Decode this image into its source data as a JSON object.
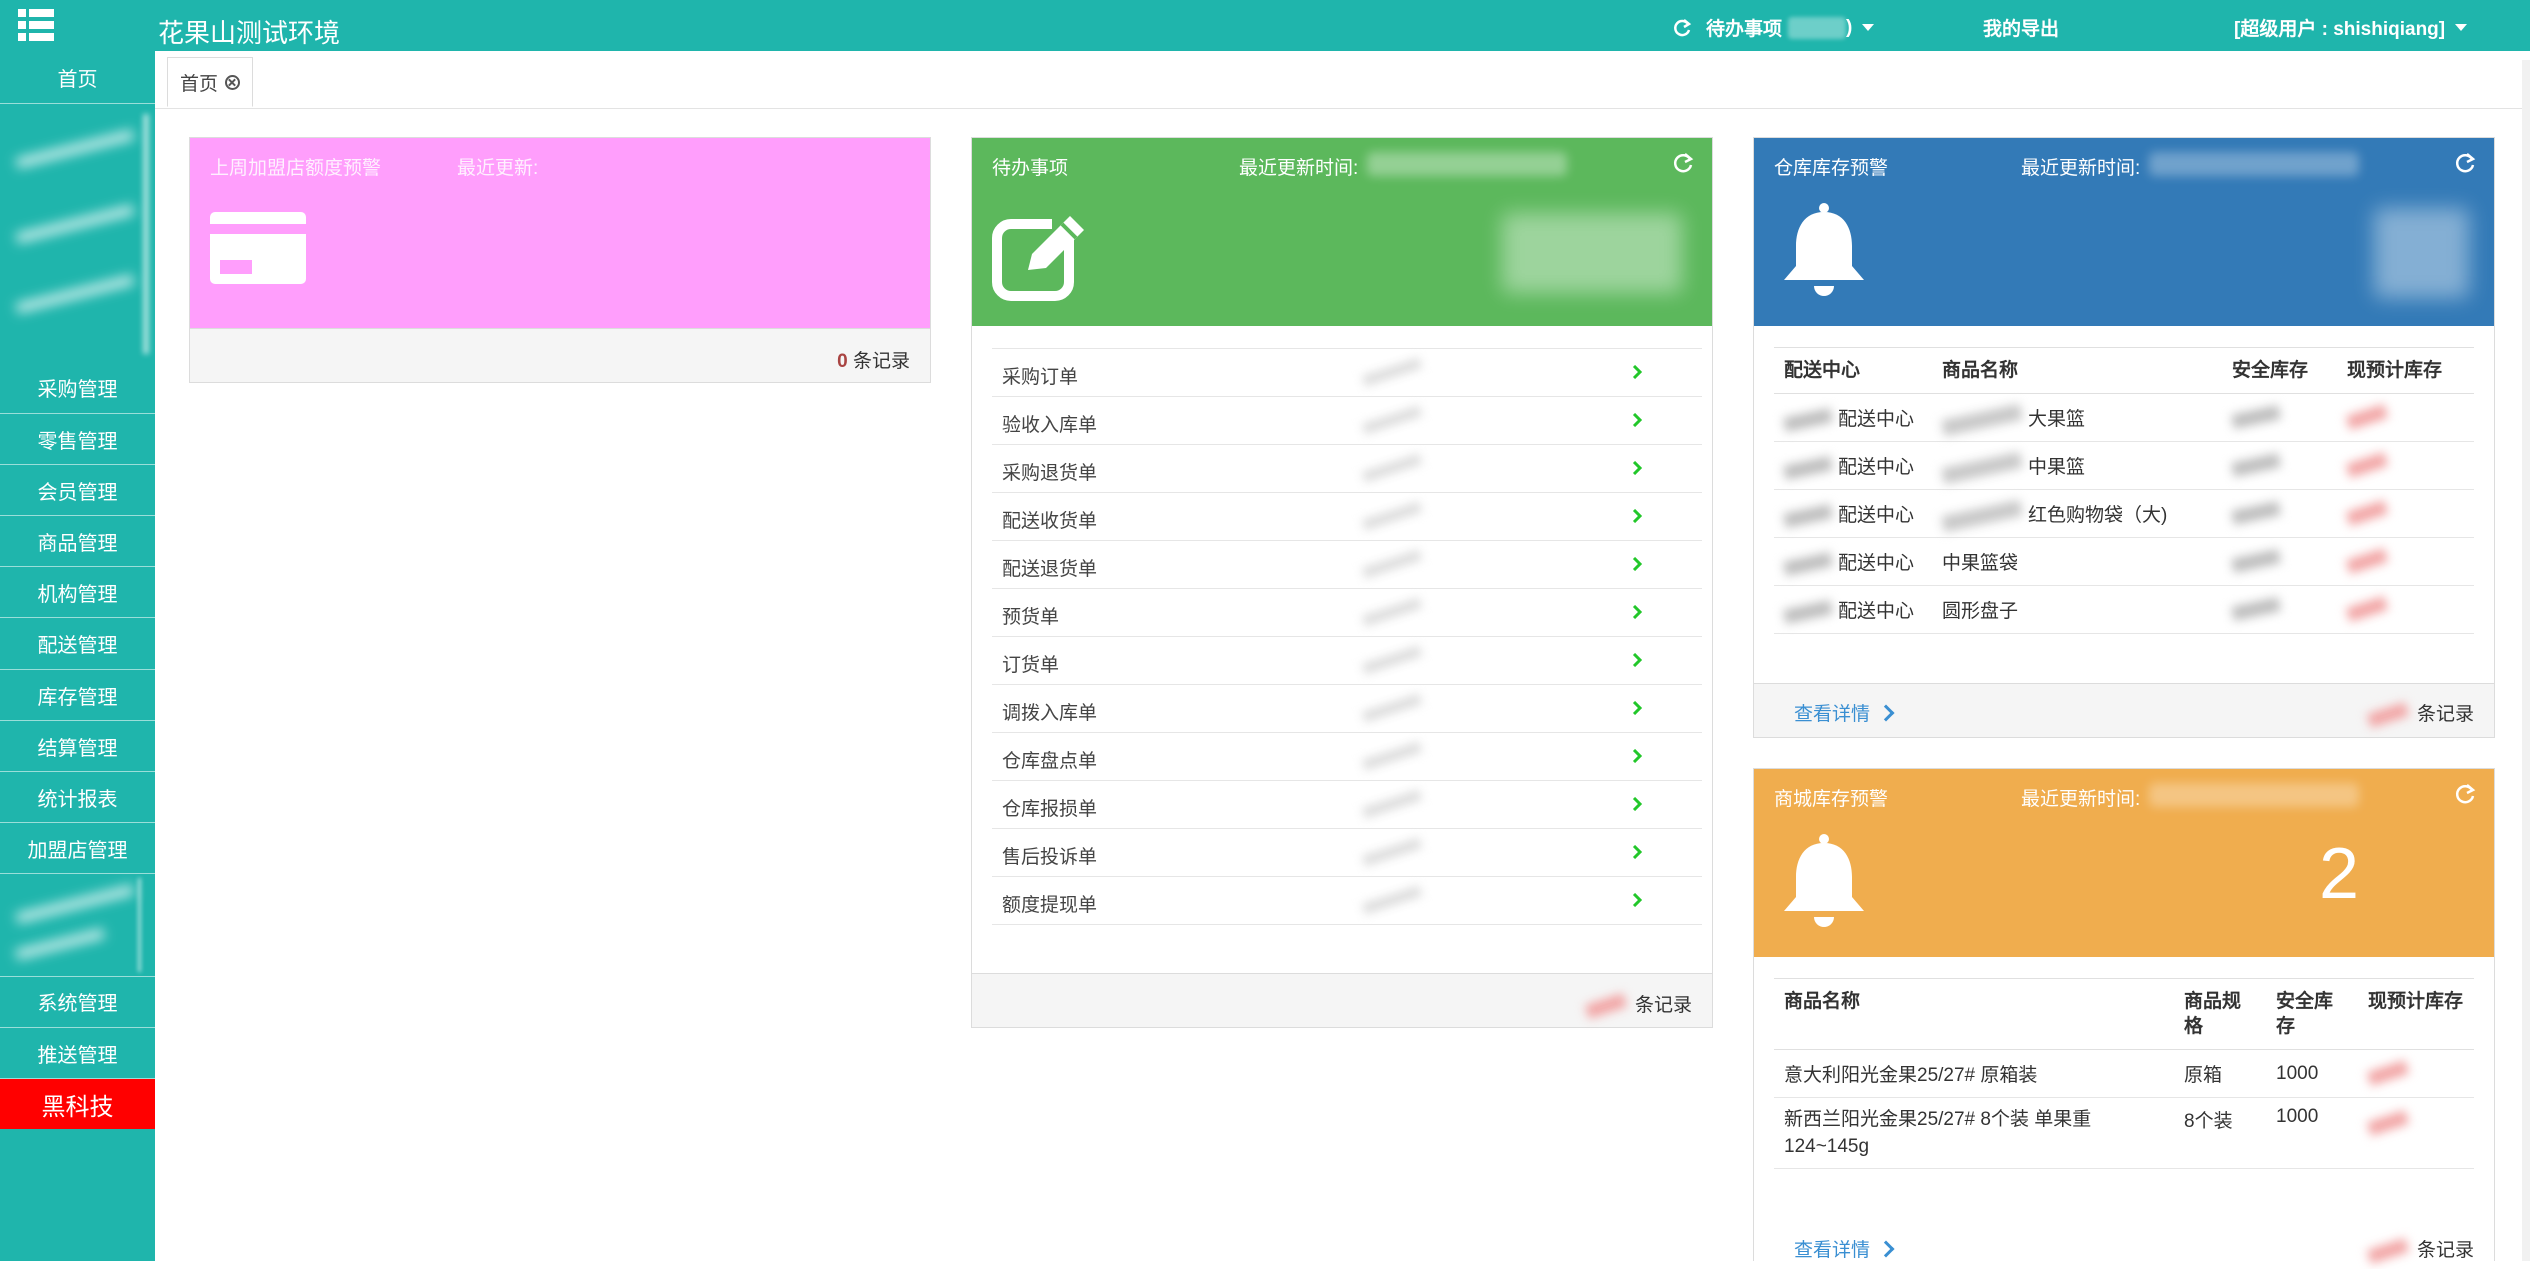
{
  "header": {
    "title": "花果山测试环境",
    "todo_label": "待办事项",
    "todo_suffix": ")",
    "export_label": "我的导出",
    "user_label": "[超级用户 : shishiqiang]"
  },
  "sidebar": {
    "home": "首页",
    "items": [
      "采购管理",
      "零售管理",
      "会员管理",
      "商品管理",
      "机构管理",
      "配送管理",
      "库存管理",
      "结算管理",
      "统计报表",
      "加盟店管理"
    ],
    "items2": [
      "系统管理",
      "推送管理"
    ],
    "hack": "黑科技"
  },
  "tabs": {
    "home": "首页"
  },
  "alert_panel": {
    "title": "上周加盟店额度预警",
    "updated": "最近更新:",
    "count": "0",
    "records_label": "条记录",
    "color": "#ff9efc"
  },
  "todo_panel": {
    "title": "待办事项",
    "updated": "最近更新时间:",
    "records_label": "条记录",
    "color": "#5cb85c",
    "items": [
      "采购订单",
      "验收入库单",
      "采购退货单",
      "配送收货单",
      "配送退货单",
      "预货单",
      "订货单",
      "调拨入库单",
      "仓库盘点单",
      "仓库报损单",
      "售后投诉单",
      "额度提现单"
    ]
  },
  "warehouse_panel": {
    "title": "仓库库存预警",
    "updated": "最近更新时间:",
    "color": "#337ab7",
    "columns": [
      "配送中心",
      "商品名称",
      "安全库存",
      "现预计库存"
    ],
    "rows": [
      {
        "center": "配送中心",
        "name": "大果篮"
      },
      {
        "center": "配送中心",
        "name": "中果篮"
      },
      {
        "center": "配送中心",
        "name": "红色购物袋（大)"
      },
      {
        "center": "配送中心",
        "name": "中果篮袋"
      },
      {
        "center": "配送中心",
        "name": "圆形盘子"
      }
    ],
    "detail_link": "查看详情",
    "records_label": "条记录"
  },
  "mall_panel": {
    "title": "商城库存预警",
    "updated": "最近更新时间:",
    "count": "2",
    "color": "#f0ad4e",
    "columns": [
      "商品名称",
      "商品规格",
      "安全库存",
      "现预计库存"
    ],
    "rows": [
      {
        "name": "意大利阳光金果25/27# 原箱装",
        "spec": "原箱",
        "safe": "1000"
      },
      {
        "name": "新西兰阳光金果25/27# 8个装 单果重124~145g",
        "spec": "8个装",
        "safe": "1000"
      }
    ],
    "detail_link": "查看详情",
    "records_label": "条记录"
  }
}
